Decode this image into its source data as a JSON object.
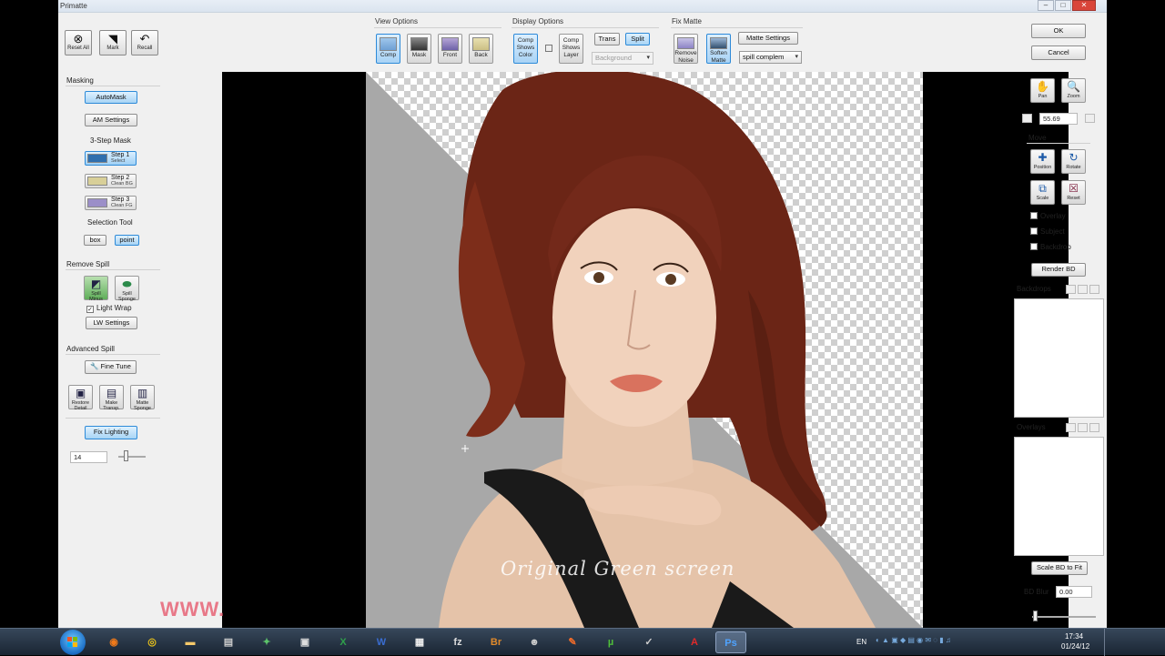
{
  "window": {
    "title": "Primatte"
  },
  "toolbar_left": [
    {
      "label": "Reset All",
      "icon": "reset-icon"
    },
    {
      "label": "Mark",
      "icon": "flag-icon"
    },
    {
      "label": "Recall",
      "icon": "undo-icon"
    }
  ],
  "view_options": {
    "title": "View Options",
    "buttons": [
      {
        "label": "Comp",
        "active": true
      },
      {
        "label": "Mask",
        "active": false
      },
      {
        "label": "Front",
        "active": false
      },
      {
        "label": "Back",
        "active": false
      }
    ]
  },
  "display_options": {
    "title": "Display Options",
    "comp_shows_color": "Comp Shows Color",
    "comp_shows_layer": "Comp Shows Layer",
    "trans": "Trans",
    "split": "Split",
    "background": "Background"
  },
  "fix_matte": {
    "title": "Fix Matte",
    "remove_noise": "Remove Noise",
    "soften_matte": "Soften Matte",
    "matte_settings": "Matte Settings",
    "spill_select": "spill complem"
  },
  "dialog": {
    "ok": "OK",
    "cancel": "Cancel"
  },
  "left_panel": {
    "masking": "Masking",
    "automask": "AutoMask",
    "am_settings": "AM Settings",
    "three_step": "3-Step Mask",
    "steps": [
      {
        "title": "Step 1",
        "sub": "Select"
      },
      {
        "title": "Step 2",
        "sub": "Clean BG"
      },
      {
        "title": "Step 3",
        "sub": "Clean FG"
      }
    ],
    "selection_tool": "Selection Tool",
    "box": "box",
    "point": "point",
    "remove_spill": "Remove Spill",
    "spill_minus": "Spill Minus",
    "spill_sponge": "Spill Sponge",
    "light_wrap": "Light Wrap",
    "light_wrap_checked": true,
    "lw_settings": "LW Settings",
    "advanced_spill": "Advanced Spill",
    "fine_tune": "Fine Tune",
    "restore_detail": "Restore Detail",
    "make_transp": "Make Transp.",
    "matte_sponge": "Matte Sponge",
    "fix_lighting": "Fix Lighting",
    "slider_value": "14"
  },
  "right_panel": {
    "pan": "Pan",
    "zoom": "Zoom",
    "zoom_value": "55.69",
    "move": "Move",
    "position": "Position",
    "rotate": "Rotate",
    "scale": "Scale",
    "reset": "Reset",
    "overlay": "Overlay",
    "subject": "Subject",
    "backdrop": "Backdrop",
    "render_bd": "Render BD",
    "backdrops": "Backdrops",
    "overlays": "Overlays",
    "scale_bd": "Scale BD to Fit",
    "bd_blur": "BD Blur",
    "bd_blur_value": "0.00"
  },
  "canvas": {
    "caption": "Original Green screen",
    "watermark": "WWW."
  },
  "taskbar": {
    "language": "EN",
    "time": "17:34",
    "date": "01/24/12",
    "apps": [
      "firefox",
      "chrome",
      "explorer",
      "ftp",
      "app",
      "media",
      "excel",
      "word",
      "notepad",
      "filezilla",
      "bridge",
      "user",
      "paint",
      "utorrent",
      "app2",
      "acrobat",
      "photoshop"
    ]
  }
}
